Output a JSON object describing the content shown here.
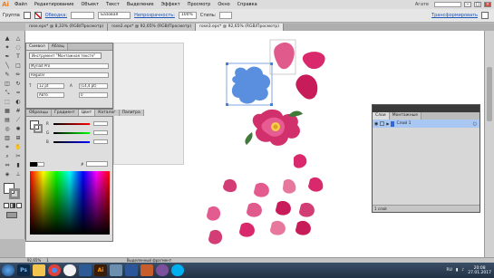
{
  "app": {
    "logo": "Ai"
  },
  "menu": [
    "Файл",
    "Редактирование",
    "Объект",
    "Текст",
    "Выделение",
    "Эффект",
    "Просмотр",
    "Окно",
    "Справка"
  ],
  "workspace": {
    "label": "Агате",
    "search_placeholder": ""
  },
  "control": {
    "selection_label": "Группа",
    "stroke_label": "Обводка:",
    "brush_value": "Базовая",
    "opacity_label": "Непрозрачность:",
    "opacity_value": "100%",
    "style_label": "Стиль:",
    "transform_label": "Трансформировать"
  },
  "tabs": [
    {
      "label": "rose.eps* @ 8,33% (RGB/Просмотр)",
      "active": false
    },
    {
      "label": "rose2.eps* @ 92,65% (RGB/Просмотр)",
      "active": false
    },
    {
      "label": "rose3.eps* @ 92,65% (RGB/Просмотр)",
      "active": true
    }
  ],
  "character_panel": {
    "tabs": [
      "Символ",
      "Абзац"
    ],
    "tool_hint": "Инструмент \"Монтажная тексте\"",
    "font": "Myriad Pro",
    "style": "Regular",
    "size": "12 pt",
    "leading": "(14,4 pt)",
    "tracking": "Авто",
    "kerning": "0"
  },
  "color_panel": {
    "tabs": [
      "Образцы",
      "Градиент",
      "Цвет",
      "Каталог",
      "Палитра"
    ],
    "channels": [
      "R",
      "G",
      "B"
    ],
    "hex_label": "#",
    "hex_value": "",
    "colors": {
      "highlight": "#1c55b8",
      "accent": "#d9286b"
    }
  },
  "layers_panel": {
    "tabs": [
      "Слои",
      "Монтажные"
    ],
    "layer_name": "Слой 1",
    "count_label": "1 слой"
  },
  "status": {
    "zoom": "92,65%",
    "page": "1",
    "mode": "Выделенный фрагмент"
  },
  "taskbar": {
    "start": "",
    "apps": [
      "Ps",
      "Explorer",
      "Chrome",
      "Яндекс",
      "Media",
      "Ai",
      "Files",
      "Word",
      "Paint",
      "Viber",
      "Skype"
    ],
    "lang": "RU",
    "time": "20:08",
    "date": "27.01.2017"
  }
}
